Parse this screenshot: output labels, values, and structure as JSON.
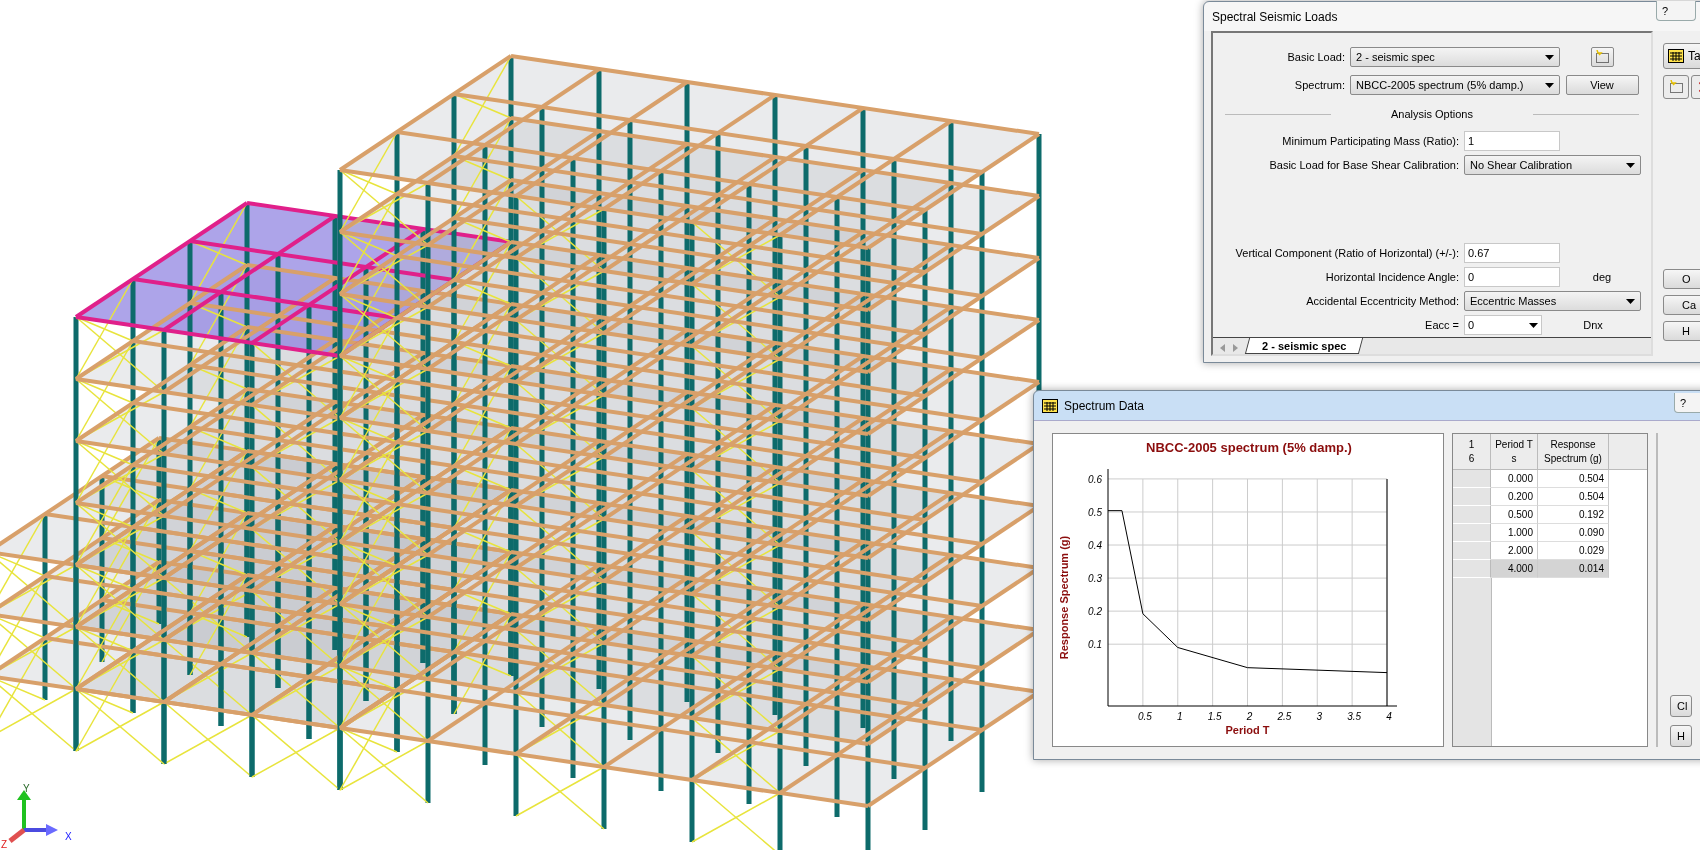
{
  "viewport": {
    "axis_labels": [
      {
        "kind": "y",
        "label": "Y"
      },
      {
        "kind": "x",
        "label": "X"
      },
      {
        "kind": "z",
        "label": "Z"
      }
    ]
  },
  "seismic_dialog": {
    "title": "Spectral Seismic Loads",
    "help": "?",
    "basic_load": {
      "label": "Basic Load:",
      "value": "2 - seismic spec"
    },
    "spectrum": {
      "label": "Spectrum:",
      "value": "NBCC-2005 spectrum (5% damp.)",
      "button": "View"
    },
    "section_title": "Analysis Options",
    "options": [
      {
        "kind": "input",
        "label": "Minimum Participating Mass (Ratio):",
        "value": "1"
      },
      {
        "kind": "select",
        "label": "Basic Load for Base Shear Calibration:",
        "value": "No Shear Calibration"
      }
    ],
    "component_options": [
      {
        "kind": "input",
        "label": "Vertical Component (Ratio of Horizontal) (+/-):",
        "value": "0.67"
      },
      {
        "kind": "input",
        "label": "Horizontal Incidence Angle:",
        "value": "0",
        "unit": "deg"
      },
      {
        "kind": "select",
        "label": "Accidental Eccentricity Method:",
        "value": "Eccentric Masses"
      },
      {
        "kind": "combo",
        "label": "Eacc =",
        "value": "0",
        "unit": "Dnx"
      }
    ],
    "sheet_tabs": [
      {
        "label": "2 - seismic spec",
        "selected": true
      }
    ],
    "table_button": "Ta",
    "side_buttons": [
      "O",
      "Ca",
      "H"
    ]
  },
  "spectrum_dialog": {
    "title": "Spectrum Data",
    "help": "?",
    "chart_data": {
      "type": "line",
      "title": "NBCC-2005 spectrum (5% damp.)",
      "xlabel": "Period T",
      "ylabel": "Response Spectrum (g)",
      "x": [
        0,
        0.2,
        0.5,
        1,
        2,
        4
      ],
      "grid": true,
      "series": [
        {
          "color": "#000000",
          "values": [
            0.504,
            0.504,
            0.192,
            0.09,
            0.029,
            0.014
          ]
        }
      ],
      "xlim": [
        0,
        4
      ],
      "ylim": [
        -0.087,
        0.63
      ],
      "xticks": [
        0.5,
        1,
        1.5,
        2,
        2.5,
        3,
        3.5,
        4
      ],
      "yticks": [
        0.1,
        0.2,
        0.3,
        0.4,
        0.5,
        0.6
      ]
    },
    "table": {
      "corner": [
        "1",
        "6"
      ],
      "columns": [
        [
          "Period T",
          "s"
        ],
        [
          "Response",
          "Spectrum (g)"
        ]
      ],
      "rows": [
        {
          "period": "0.000",
          "response": "0.504",
          "selected": false
        },
        {
          "period": "0.200",
          "response": "0.504",
          "selected": false
        },
        {
          "period": "0.500",
          "response": "0.192",
          "selected": false
        },
        {
          "period": "1.000",
          "response": "0.090",
          "selected": false
        },
        {
          "period": "2.000",
          "response": "0.029",
          "selected": false
        },
        {
          "period": "4.000",
          "response": "0.014",
          "selected": true
        }
      ]
    },
    "side_buttons": [
      "Cl",
      "H"
    ]
  }
}
